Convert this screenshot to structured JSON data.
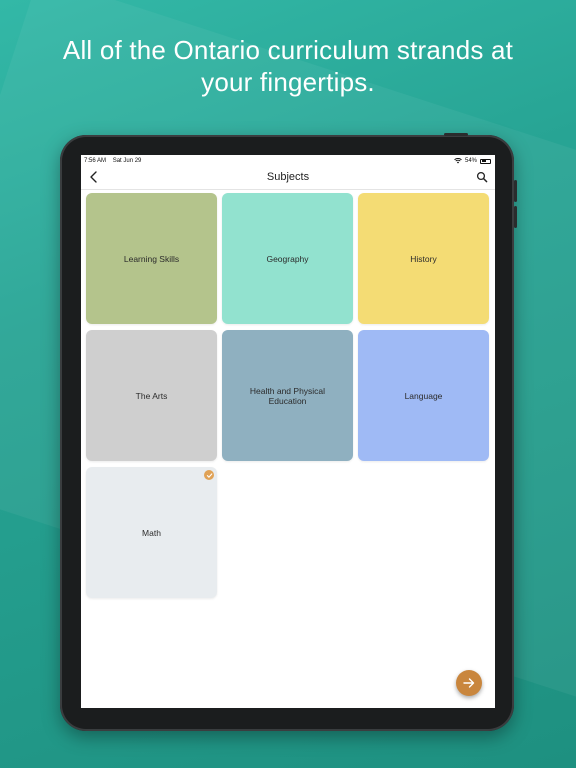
{
  "headline": {
    "line1": "All of the Ontario curriculum strands at",
    "line2": "your fingertips."
  },
  "status_bar": {
    "time": "7:56 AM",
    "date": "Sat Jun 29",
    "battery": "54%",
    "battery_level": 0.54
  },
  "nav": {
    "title": "Subjects",
    "back_icon": "chevron-left-icon",
    "search_icon": "search-icon"
  },
  "subjects": [
    {
      "label": "Learning Skills",
      "color": "#b4c48c"
    },
    {
      "label": "Geography",
      "color": "#92e2cf"
    },
    {
      "label": "History",
      "color": "#f4dc74"
    },
    {
      "label": "The Arts",
      "color": "#cfcfcf"
    },
    {
      "label": "Health and Physical Education",
      "color": "#8fb0c0"
    },
    {
      "label": "Language",
      "color": "#9fbaf5"
    },
    {
      "label": "Math",
      "color": "#e8ecef",
      "checked": true
    }
  ],
  "fab": {
    "icon": "arrow-right-icon",
    "color": "#c9863d"
  },
  "colors": {
    "background": "#27a494",
    "device_frame": "#1b1d1e",
    "check_badge": "#e0a256"
  }
}
